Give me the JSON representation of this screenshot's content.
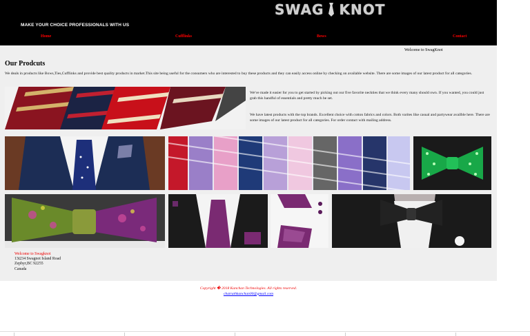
{
  "header": {
    "logo_left": "SWAG",
    "logo_right": "KNOT",
    "tagline": "MAKE YOUR CHOICE PROFESSIONALS WITH US"
  },
  "nav": {
    "items": [
      {
        "label": "Home"
      },
      {
        "label": "Cufflinks"
      },
      {
        "label": "Bows"
      },
      {
        "label": "Contact"
      }
    ]
  },
  "main": {
    "welcome": "Welcome to SwagKnot",
    "title": "Our Prodcuts",
    "intro": "We deals in products like Bows,Ties,Cufflinks and provide best quality products in market.This site being useful for the consumers who are interested to buy these products and they can easily access online by checking on available website. There are some images of our latest product for all categories.",
    "para1": "We've made it easier for you to get started by picking out our five favorite neckties that we think every many should own. If you wanted, you could just grab this handful of essentials and pretty much be set.",
    "para2": "We have latest products with the top brands. Excellent choice with cotton fabrics and colors. Both varites like casual and partywear availble here. There are some images of our latest product for all categories. For order contact with mailing address."
  },
  "address": {
    "heading": "Welcome to Swagknot",
    "line1": "13t234 Swagnot Island Road",
    "line2": "Zephyr,BC 92255",
    "line3": "Canada"
  },
  "footer": {
    "copyright": "Copyright � 2018 Kanchan Technologies. All rights reserved.",
    "email": "chatrathkanchan00@gmail.com"
  },
  "colors": {
    "header_bg": "#000000",
    "nav_link": "#ff0000",
    "content_bg": "#efefef",
    "link_blue": "#0000ff"
  }
}
